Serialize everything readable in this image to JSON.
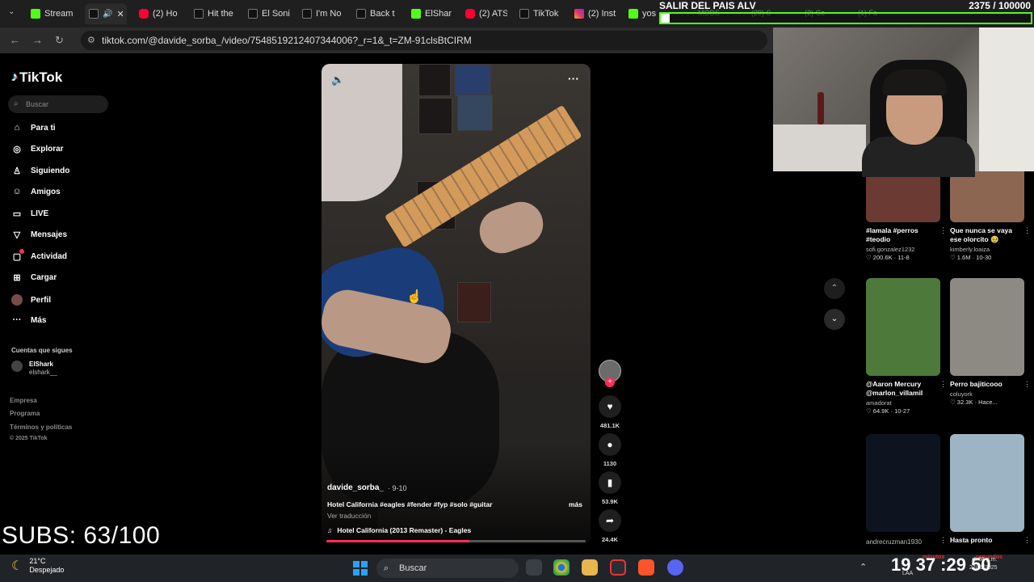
{
  "browser": {
    "tabs": [
      {
        "icon": "kick-icon",
        "label": "Stream"
      },
      {
        "icon": "tiktok-icon",
        "label": ""
      },
      {
        "icon": "youtube-icon",
        "label": "(2) Ho"
      },
      {
        "icon": "tiktok-icon",
        "label": "Hit the"
      },
      {
        "icon": "tiktok-icon",
        "label": "El Soni"
      },
      {
        "icon": "tiktok-icon",
        "label": "I'm No"
      },
      {
        "icon": "tiktok-icon",
        "label": "Back t"
      },
      {
        "icon": "kick-icon",
        "label": "ElShar"
      },
      {
        "icon": "youtube-icon",
        "label": "(2) ATS"
      },
      {
        "icon": "tiktok-icon",
        "label": "TikTok"
      },
      {
        "icon": "instagram-icon",
        "label": "(2) Inst"
      },
      {
        "icon": "kick-icon",
        "label": "yos"
      }
    ],
    "ghost_tabs": [
      "MODS",
      "(29) S",
      "(2) Co",
      "(1) Fa"
    ],
    "url": "tiktok.com/@davide_sorba_/video/7548519212407344006?_r=1&_t=ZM-91clsBtCIRM"
  },
  "stream_goal": {
    "title": "SALIR DEL PAIS ALV",
    "current": "2375",
    "target": "/ 100000",
    "progress": 0.02375
  },
  "sidebar": {
    "brand": "TikTok",
    "search_placeholder": "Buscar",
    "items": [
      {
        "icon": "home-icon",
        "label": "Para ti"
      },
      {
        "icon": "compass-icon",
        "label": "Explorar"
      },
      {
        "icon": "following-icon",
        "label": "Siguiendo"
      },
      {
        "icon": "friends-icon",
        "label": "Amigos"
      },
      {
        "icon": "live-icon",
        "label": "LIVE"
      },
      {
        "icon": "messages-icon",
        "label": "Mensajes"
      },
      {
        "icon": "activity-icon",
        "label": "Actividad"
      },
      {
        "icon": "upload-icon",
        "label": "Cargar"
      },
      {
        "icon": "profile-icon",
        "label": "Perfil"
      },
      {
        "icon": "more-icon",
        "label": "Más"
      }
    ],
    "following_title": "Cuentas que sigues",
    "following_user": {
      "name": "ElShark",
      "handle": "elshark__"
    },
    "footer": [
      "Empresa",
      "Programa",
      "Términos y políticas",
      "© 2025 TikTok"
    ]
  },
  "video": {
    "author": "davide_sorba_",
    "date": "· 9-10",
    "caption": "Hotel California #eagles #fender #fyp #solo #guitar",
    "more": "más",
    "translate": "Ver traducción",
    "music": "Hotel California (2013 Remaster) - Eagles",
    "progress": 0.55,
    "actions": {
      "likes": "481.1K",
      "comments": "1130",
      "saves": "53.9K",
      "shares": "24.4K"
    }
  },
  "grid": [
    {
      "title": "#lamala #perros #teodio",
      "user": "sofi.gonzalez1232",
      "stats": "♡ 200.6K · 11-8",
      "thumb_color": "#6b3a33"
    },
    {
      "title": "Que nunca se vaya ese olorcito 🥹",
      "user": "kimberly.loaiza",
      "stats": "♡ 1.6M · 10-30",
      "thumb_color": "#8c6650"
    },
    {
      "title": "@Aaron Mercury @marlon_villamil",
      "user": "amadorat",
      "stats": "♡ 64.9K · 10-27",
      "thumb_color": "#4d7a3a"
    },
    {
      "title": "Perro bajiticooo",
      "user": "coluyork",
      "stats": "♡ 32.3K · Hace...",
      "thumb_color": "#8d8a84"
    },
    {
      "title": "",
      "user": "andrecruzman1930",
      "stats": "",
      "thumb_color": "#0d1420"
    },
    {
      "title": "Hasta pronto",
      "user": "",
      "stats": "",
      "thumb_color": "#9cb4c4"
    }
  ],
  "overlay": {
    "subs": "SUBS: 63/100"
  },
  "taskbar": {
    "temp": "21°C",
    "weather": "Despejado",
    "search": "Buscar",
    "clock_big": "19 37 :29 50",
    "time_small": "6:36 p.m.",
    "date_small": "22/11/2025",
    "lang": "LAA",
    "red_a": "minutos",
    "red_b": "segundos"
  }
}
